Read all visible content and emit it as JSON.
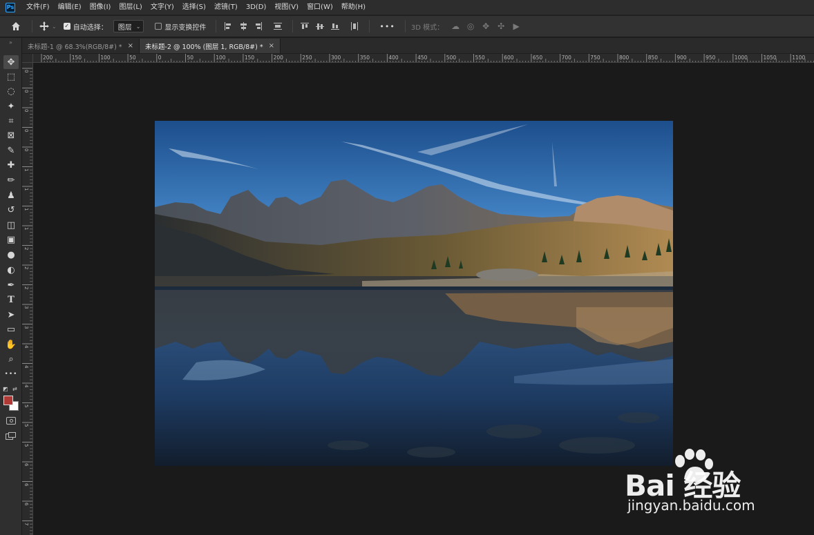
{
  "app": {
    "logo_text": "Ps"
  },
  "menu": [
    "文件(F)",
    "编辑(E)",
    "图像(I)",
    "图层(L)",
    "文字(Y)",
    "选择(S)",
    "滤镜(T)",
    "3D(D)",
    "视图(V)",
    "窗口(W)",
    "帮助(H)"
  ],
  "options_bar": {
    "auto_select_label": "自动选择：",
    "auto_select_checked": true,
    "layer_target_value": "图层",
    "show_transform_label": "显示变换控件",
    "show_transform_checked": false,
    "more_label": "•••",
    "mode_3d_label": "3D 模式："
  },
  "tabs": [
    {
      "label": "未标题-1 @ 68.3%(RGB/8#) *",
      "active": false
    },
    {
      "label": "未标题-2 @ 100% (图层 1, RGB/8#) *",
      "active": true
    }
  ],
  "ruler_top_labels": [
    "200",
    "150",
    "100",
    "50",
    "0",
    "50",
    "100",
    "150",
    "200",
    "250",
    "300",
    "350",
    "400",
    "450",
    "500",
    "550",
    "600",
    "650",
    "700",
    "750",
    "800",
    "850",
    "900",
    "950",
    "1000",
    "1050",
    "1100"
  ],
  "ruler_left_labels": [
    "0",
    "0",
    "0",
    "0",
    "0",
    "1",
    "1",
    "1",
    "1",
    "2",
    "2",
    "2",
    "3",
    "3",
    "4",
    "4",
    "4",
    "5",
    "5",
    "5",
    "6",
    "6",
    "6",
    "7"
  ],
  "tools": [
    {
      "name": "move-tool",
      "glyph": "✥",
      "selected": true
    },
    {
      "name": "marquee-tool",
      "glyph": "⬚"
    },
    {
      "name": "lasso-tool",
      "glyph": "◌"
    },
    {
      "name": "magic-wand-tool",
      "glyph": "✦"
    },
    {
      "name": "crop-tool",
      "glyph": "⌗"
    },
    {
      "name": "frame-tool",
      "glyph": "⊠"
    },
    {
      "name": "eyedropper-tool",
      "glyph": "✎"
    },
    {
      "name": "healing-brush-tool",
      "glyph": "✚"
    },
    {
      "name": "brush-tool",
      "glyph": "✏"
    },
    {
      "name": "clone-stamp-tool",
      "glyph": "♟"
    },
    {
      "name": "history-brush-tool",
      "glyph": "↺"
    },
    {
      "name": "eraser-tool",
      "glyph": "◫"
    },
    {
      "name": "gradient-tool",
      "glyph": "▣"
    },
    {
      "name": "blur-tool",
      "glyph": "●"
    },
    {
      "name": "dodge-tool",
      "glyph": "◐"
    },
    {
      "name": "pen-tool",
      "glyph": "✒"
    },
    {
      "name": "type-tool",
      "glyph": "T"
    },
    {
      "name": "path-selection-tool",
      "glyph": "➤"
    },
    {
      "name": "rectangle-tool",
      "glyph": "▭"
    },
    {
      "name": "hand-tool",
      "glyph": "✋"
    },
    {
      "name": "zoom-tool",
      "glyph": "⌕"
    },
    {
      "name": "edit-toolbar",
      "glyph": "•••"
    }
  ],
  "colors": {
    "foreground": "#b03a36",
    "background": "#ffffff",
    "accent": "#31a8ff"
  },
  "watermark": {
    "main": "Bai 经验",
    "sub": "jingyan.baidu.com"
  }
}
